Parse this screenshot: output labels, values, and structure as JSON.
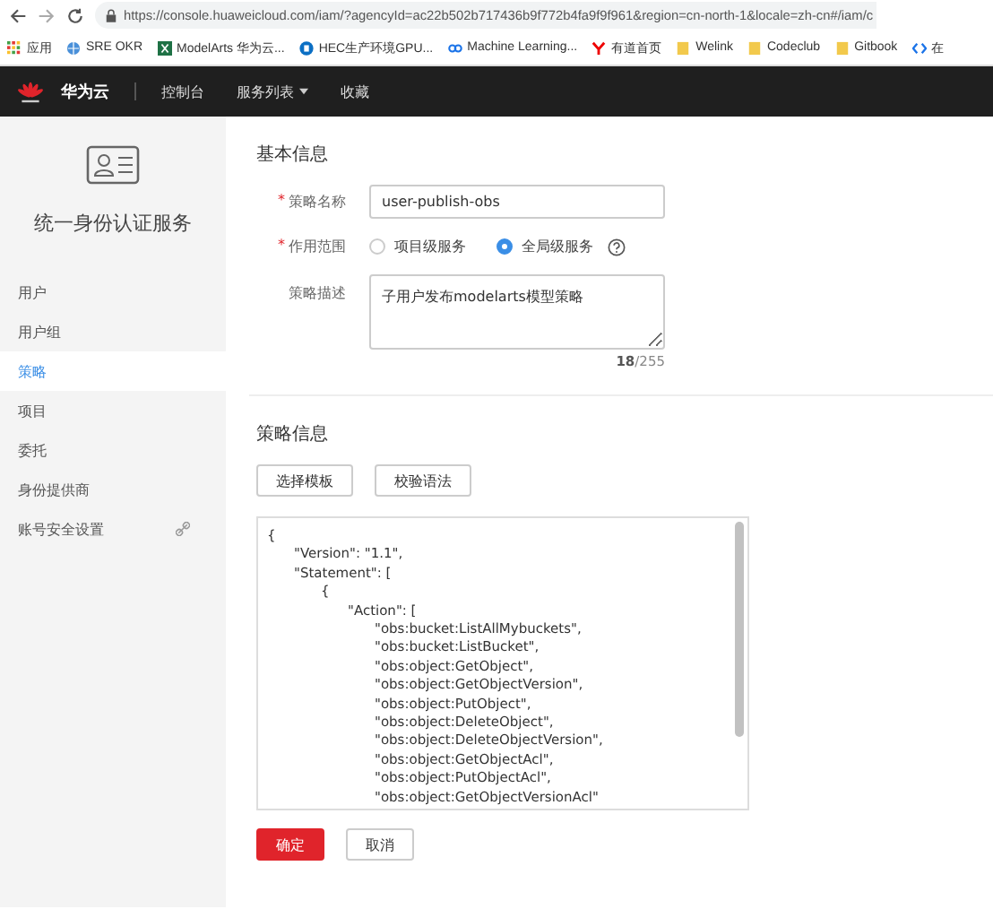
{
  "browser": {
    "url": "https://console.huaweicloud.com/iam/?agencyId=ac22b502b717436b9f772b4fa9f9f961&region=cn-north-1&locale=zh-cn#/iam/c",
    "bookmarks": [
      {
        "kind": "apps",
        "label": "应用"
      },
      {
        "kind": "globe",
        "label": "SRE OKR"
      },
      {
        "kind": "excel",
        "label": "ModelArts 华为云..."
      },
      {
        "kind": "sharepoint",
        "label": "HEC生产环境GPU..."
      },
      {
        "kind": "link",
        "label": "Machine Learning..."
      },
      {
        "kind": "youdao",
        "label": "有道首页"
      },
      {
        "kind": "folder",
        "label": "Welink"
      },
      {
        "kind": "folder",
        "label": "Codeclub"
      },
      {
        "kind": "folder",
        "label": "Gitbook"
      },
      {
        "kind": "code",
        "label": "在"
      }
    ]
  },
  "header": {
    "brand": "华为云",
    "nav": [
      {
        "label": "控制台",
        "dropdown": false
      },
      {
        "label": "服务列表",
        "dropdown": true
      },
      {
        "label": "收藏",
        "dropdown": false
      }
    ]
  },
  "sidebar": {
    "title": "统一身份认证服务",
    "items": [
      {
        "label": "用户",
        "selected": false,
        "link": false
      },
      {
        "label": "用户组",
        "selected": false,
        "link": false
      },
      {
        "label": "策略",
        "selected": true,
        "link": false
      },
      {
        "label": "项目",
        "selected": false,
        "link": false
      },
      {
        "label": "委托",
        "selected": false,
        "link": false
      },
      {
        "label": "身份提供商",
        "selected": false,
        "link": false
      },
      {
        "label": "账号安全设置",
        "selected": false,
        "link": true
      }
    ]
  },
  "basic": {
    "heading": "基本信息",
    "name_field": {
      "label": "策略名称",
      "required_mark": "*",
      "value": "user-publish-obs"
    },
    "scope": {
      "label": "作用范围",
      "required_mark": "*",
      "options": [
        {
          "label": "项目级服务",
          "selected": false
        },
        {
          "label": "全局级服务",
          "selected": true
        }
      ]
    },
    "description": {
      "label": "策略描述",
      "value": "子用户发布modelarts模型策略",
      "count": "18",
      "limit": "/255"
    }
  },
  "policy": {
    "heading": "策略信息",
    "buttons": [
      "选择模板",
      "校验语法"
    ],
    "code": [
      {
        "text": "{",
        "children": [
          {
            "text": "\"Version\": \"1.1\","
          },
          {
            "text": "\"Statement\": [",
            "children": [
              {
                "text": "{",
                "children": [
                  {
                    "text": "\"Action\": [",
                    "children": [
                      {
                        "text": "\"obs:bucket:ListAllMybuckets\","
                      },
                      {
                        "text": "\"obs:bucket:ListBucket\","
                      },
                      {
                        "text": "\"obs:object:GetObject\","
                      },
                      {
                        "text": "\"obs:object:GetObjectVersion\","
                      },
                      {
                        "text": "\"obs:object:PutObject\","
                      },
                      {
                        "text": "\"obs:object:DeleteObject\","
                      },
                      {
                        "text": "\"obs:object:DeleteObjectVersion\","
                      },
                      {
                        "text": "\"obs:object:GetObjectAcl\","
                      },
                      {
                        "text": "\"obs:object:PutObjectAcl\","
                      },
                      {
                        "text": "\"obs:object:GetObjectVersionAcl\""
                      }
                    ]
                  }
                ]
              }
            ]
          }
        ]
      }
    ]
  },
  "actions": [
    {
      "label": "确定",
      "kind": "primary"
    },
    {
      "label": "取消",
      "kind": "secondary"
    }
  ]
}
